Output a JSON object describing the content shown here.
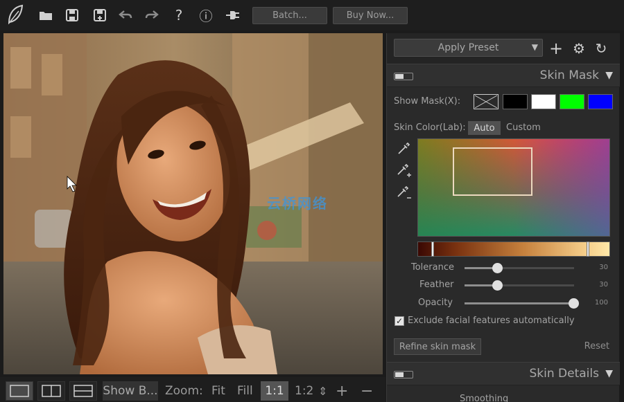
{
  "toolbar": {
    "icons": [
      "leaf-logo-icon",
      "folder-open-icon",
      "save-icon",
      "save-as-icon",
      "undo-icon",
      "redo-icon",
      "help-icon",
      "info-icon",
      "plugin-icon"
    ],
    "help_glyph": "?",
    "info_glyph": "ⓘ",
    "batch_label": "Batch...",
    "buy_label": "Buy Now..."
  },
  "bottom_bar": {
    "view_modes": [
      "single-view",
      "split-vertical-view",
      "split-horizontal-view"
    ],
    "active_view": "single-view",
    "show_before_label": "Show B...",
    "zoom_label": "Zoom:",
    "fit_label": "Fit",
    "fill_label": "Fill",
    "one_to_one_label": "1:1",
    "one_to_two_label": "1:2",
    "zoom_in_glyph": "+",
    "zoom_out_glyph": "−",
    "stepper_glyph": "⇕"
  },
  "panel": {
    "preset_label": "Apply Preset",
    "preset_caret": "▼",
    "add_glyph": "+",
    "settings_glyph": "⚙",
    "refresh_glyph": "↻",
    "skin_mask": {
      "title": "Skin Mask",
      "caret": "▼",
      "show_mask_label": "Show Mask(X):",
      "mask_swatches": [
        "#000000",
        "#ffffff",
        "#00ff00",
        "#0000ff"
      ],
      "skin_color_label": "Skin Color(Lab):",
      "auto_label": "Auto",
      "custom_label": "Custom",
      "tolerance_label": "Tolerance",
      "tolerance_value": "30",
      "feather_label": "Feather",
      "feather_value": "30",
      "opacity_label": "Opacity",
      "opacity_value": "100",
      "exclude_label": "Exclude facial features automatically",
      "exclude_checked": true,
      "refine_label": "Refine skin mask",
      "reset_label": "Reset"
    },
    "skin_details": {
      "title": "Skin Details",
      "caret": "▼",
      "smoothing_label": "Smoothing"
    }
  },
  "watermark": "云桥网络",
  "colors": {
    "bg": "#1b1b1b",
    "panel": "#2a2a2a",
    "green_swatch": "#00ff00",
    "blue_swatch": "#0000ff"
  }
}
